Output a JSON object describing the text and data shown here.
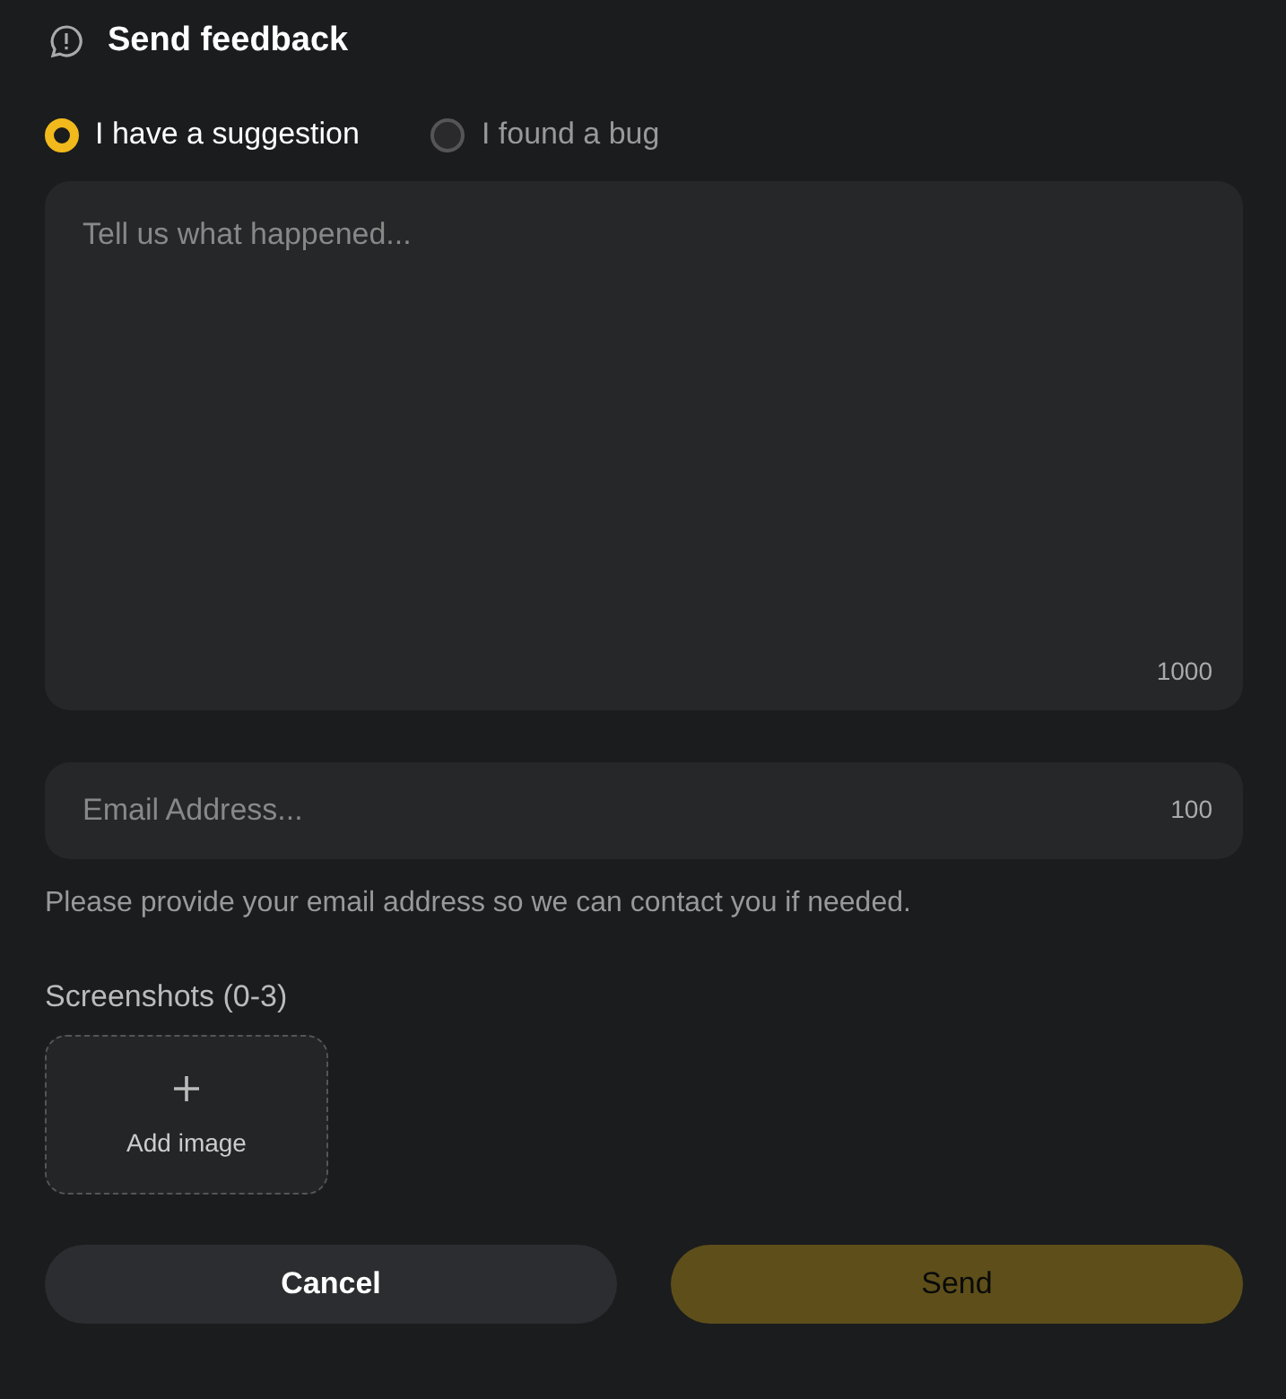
{
  "title": "Send feedback",
  "feedback_types": [
    {
      "label": "I have a suggestion",
      "selected": true
    },
    {
      "label": "I found a bug",
      "selected": false
    }
  ],
  "description": {
    "placeholder": "Tell us what happened...",
    "limit": "1000"
  },
  "email": {
    "placeholder": "Email Address...",
    "limit": "100"
  },
  "email_hint": "Please provide your email address so we can contact you if needed.",
  "screenshots": {
    "label": "Screenshots (0-3)",
    "add_label": "Add image"
  },
  "buttons": [
    {
      "label": "Cancel",
      "kind": "secondary",
      "disabled": false
    },
    {
      "label": "Send",
      "kind": "primary",
      "disabled": true
    }
  ]
}
